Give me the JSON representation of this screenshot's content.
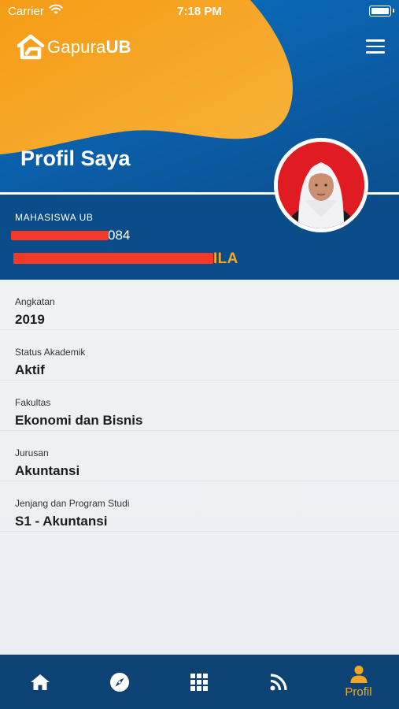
{
  "status_bar": {
    "carrier": "Carrier",
    "time": "7:18 PM"
  },
  "brand": {
    "prefix": "Gapura",
    "suffix": "UB"
  },
  "page_title": "Profil Saya",
  "identity": {
    "role": "MAHASISWA UB",
    "nim_visible": "084",
    "name_visible": "ILA"
  },
  "info": [
    {
      "label": "Angkatan",
      "value": "2019"
    },
    {
      "label": "Status Akademik",
      "value": "Aktif"
    },
    {
      "label": "Fakultas",
      "value": "Ekonomi dan Bisnis"
    },
    {
      "label": "Jurusan",
      "value": "Akuntansi"
    },
    {
      "label": "Jenjang dan Program Studi",
      "value": "S1 - Akuntansi"
    }
  ],
  "tabbar": {
    "items": [
      {
        "icon": "home-icon"
      },
      {
        "icon": "compass-icon"
      },
      {
        "icon": "grid-icon"
      },
      {
        "icon": "rss-icon"
      },
      {
        "icon": "person-icon",
        "label": "Profil",
        "active": true
      }
    ]
  },
  "colors": {
    "primary_blue": "#0b5ea8",
    "dark_blue": "#0b4d8a",
    "tabbar": "#0d4374",
    "accent_orange": "#f5a623",
    "redaction": "#f23a26"
  }
}
